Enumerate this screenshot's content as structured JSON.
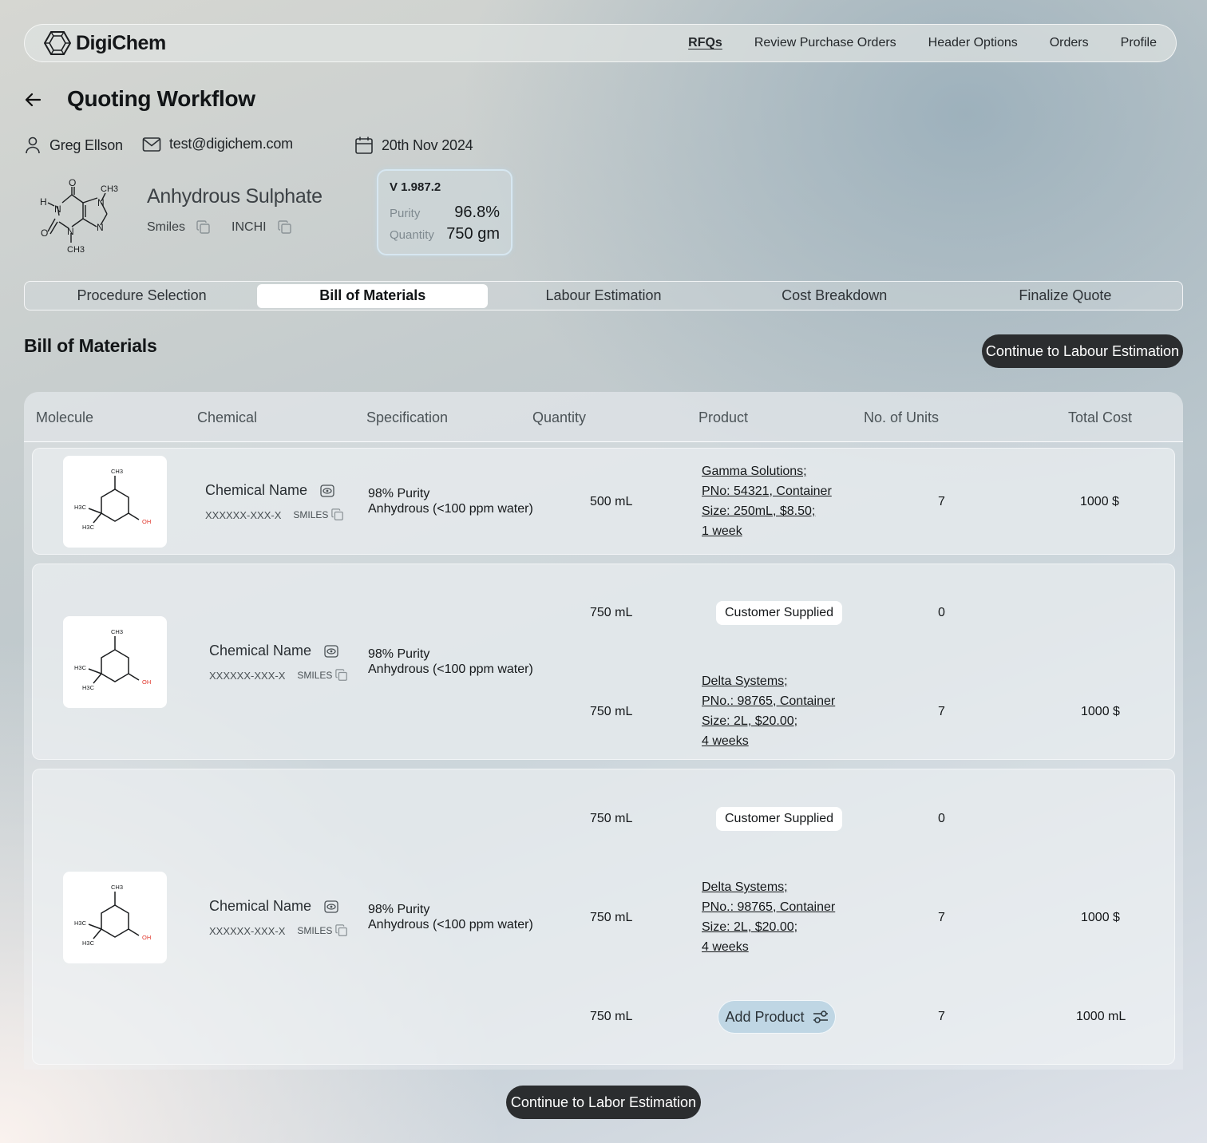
{
  "nav": {
    "brand": "DigiChem",
    "links": [
      "RFQs",
      "Review Purchase Orders",
      "Header Options",
      "Orders",
      "Profile"
    ],
    "active": "RFQs"
  },
  "header": {
    "title": "Quoting Workflow",
    "user": "Greg Ellson",
    "email": "test@digichem.com",
    "date": "20th Nov 2024"
  },
  "compound": {
    "name": "Anhydrous Sulphate",
    "smiles_label": "Smiles",
    "inchi_label": "INCHI"
  },
  "version_card": {
    "version": "V 1.987.2",
    "purity_label": "Purity",
    "purity": "96.8%",
    "quantity_label": "Quantity",
    "quantity": "750 gm"
  },
  "tabs": [
    "Procedure Selection",
    "Bill of Materials",
    "Labour Estimation",
    "Cost Breakdown",
    "Finalize Quote"
  ],
  "active_tab": "Bill of Materials",
  "section": {
    "title": "Bill of Materials",
    "continue_top": "Continue to Labour Estimation",
    "continue_bottom": "Continue to Labor Estimation"
  },
  "table": {
    "columns": [
      "Molecule",
      "Chemical",
      "Specification",
      "Quantity",
      "Product",
      "No. of Units",
      "Total Cost"
    ],
    "rows": [
      {
        "chemical_name": "Chemical Name",
        "cas": "XXXXXX-XXX-X",
        "smiles": "SMILES",
        "spec_1": "98% Purity",
        "spec_2": "Anhydrous (<100 ppm water)",
        "lines": [
          {
            "quantity": "500 mL",
            "product": [
              "Gamma Solutions;",
              "PNo: 54321, Container",
              "Size: 250mL, $8.50;",
              "1 week"
            ],
            "units": "7",
            "cost": "1000 $"
          }
        ]
      },
      {
        "chemical_name": "Chemical Name",
        "cas": "XXXXXX-XXX-X",
        "smiles": "SMILES",
        "spec_1": "98% Purity",
        "spec_2": "Anhydrous (<100 ppm water)",
        "lines": [
          {
            "quantity": "750 mL",
            "product_pill": "Customer Supplied",
            "units": "0",
            "cost": ""
          },
          {
            "quantity": "750 mL",
            "product": [
              "Delta Systems;",
              "PNo.: 98765, Container",
              "Size: 2L, $20.00;",
              "4 weeks"
            ],
            "units": "7",
            "cost": "1000 $"
          }
        ]
      },
      {
        "chemical_name": "Chemical Name",
        "cas": "XXXXXX-XXX-X",
        "smiles": "SMILES",
        "spec_1": "98% Purity",
        "spec_2": "Anhydrous (<100 ppm water)",
        "lines": [
          {
            "quantity": "750 mL",
            "product_pill": "Customer Supplied",
            "units": "0",
            "cost": ""
          },
          {
            "quantity": "750 mL",
            "product": [
              "Delta Systems;",
              "PNo.: 98765, Container",
              "Size: 2L, $20.00;",
              "4 weeks"
            ],
            "units": "7",
            "cost": "1000 $"
          },
          {
            "quantity": "750 mL",
            "product_button": "Add Product",
            "units": "7",
            "cost": "1000 mL"
          }
        ]
      }
    ]
  },
  "molecule_labels": {
    "ch3": "CH3",
    "h3c": "H3C",
    "oh": "OH"
  },
  "caffeine_labels": {
    "o": "O",
    "n": "N",
    "h": "H",
    "ch3": "CH3"
  },
  "colors": {
    "accent_dark": "#2b2d2f",
    "add_product_bg": "#b7d2e2",
    "oh_red": "#e0342a"
  }
}
